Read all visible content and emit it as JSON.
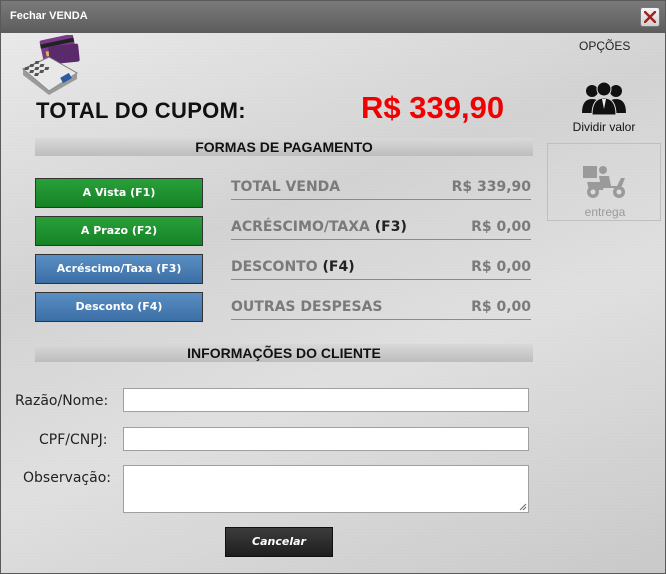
{
  "window": {
    "title": "Fechar VENDA"
  },
  "total": {
    "label": "TOTAL DO CUPOM:",
    "value": "R$ 339,90"
  },
  "payment": {
    "header": "FORMAS DE PAGAMENTO",
    "buttons": [
      {
        "label": "A Vista (F1)"
      },
      {
        "label": "A Prazo (F2)"
      },
      {
        "label": "Acréscimo/Taxa (F3)"
      },
      {
        "label": "Desconto (F4)"
      }
    ]
  },
  "summary": [
    {
      "label": "TOTAL VENDA",
      "key": "",
      "value": "R$ 339,90"
    },
    {
      "label": "ACRÉSCIMO/TAXA ",
      "key": "(F3)",
      "value": "R$ 0,00"
    },
    {
      "label": "DESCONTO ",
      "key": "(F4)",
      "value": "R$ 0,00"
    },
    {
      "label": "OUTRAS DESPESAS",
      "key": "",
      "value": "R$ 0,00"
    }
  ],
  "client": {
    "header": "INFORMAÇÕES DO CLIENTE",
    "name_label": "Razão/Nome:",
    "name_value": "",
    "doc_label": "CPF/CNPJ:",
    "doc_value": "",
    "obs_label": "Observação:",
    "obs_value": ""
  },
  "actions": {
    "cancel_label": "Cancelar"
  },
  "options": {
    "title": "OPÇÕES",
    "split_label": "Dividir valor",
    "delivery_label": "entrega"
  },
  "colors": {
    "total_value": "#f00000",
    "green_button": "#1a8a2a",
    "blue_button": "#3a6ea4"
  }
}
